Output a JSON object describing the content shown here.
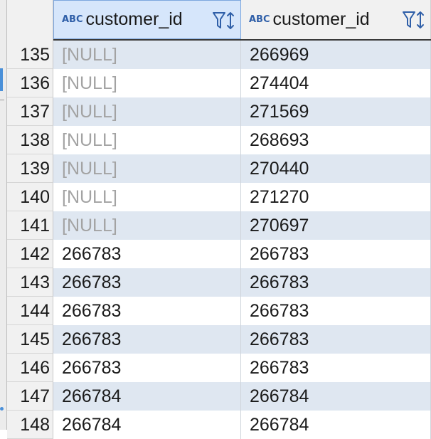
{
  "columns": [
    {
      "type_icon": "ABC",
      "title": "customer_id"
    },
    {
      "type_icon": "ABC",
      "title": "customer_id"
    }
  ],
  "rows": [
    {
      "num": "135",
      "c1": "[NULL]",
      "c2": "266969"
    },
    {
      "num": "136",
      "c1": "[NULL]",
      "c2": "274404"
    },
    {
      "num": "137",
      "c1": "[NULL]",
      "c2": "271569"
    },
    {
      "num": "138",
      "c1": "[NULL]",
      "c2": "268693"
    },
    {
      "num": "139",
      "c1": "[NULL]",
      "c2": "270440"
    },
    {
      "num": "140",
      "c1": "[NULL]",
      "c2": "271270"
    },
    {
      "num": "141",
      "c1": "[NULL]",
      "c2": "270697"
    },
    {
      "num": "142",
      "c1": "266783",
      "c2": "266783"
    },
    {
      "num": "143",
      "c1": "266783",
      "c2": "266783"
    },
    {
      "num": "144",
      "c1": "266783",
      "c2": "266783"
    },
    {
      "num": "145",
      "c1": "266783",
      "c2": "266783"
    },
    {
      "num": "146",
      "c1": "266783",
      "c2": "266783"
    },
    {
      "num": "147",
      "c1": "266784",
      "c2": "266784"
    },
    {
      "num": "148",
      "c1": "266784",
      "c2": "266784"
    }
  ],
  "colors": {
    "accent": "#4a90d9",
    "selected_header": "#d6e6fb",
    "alt_row": "#dfe7f1",
    "null_text": "#a3a3a3"
  }
}
